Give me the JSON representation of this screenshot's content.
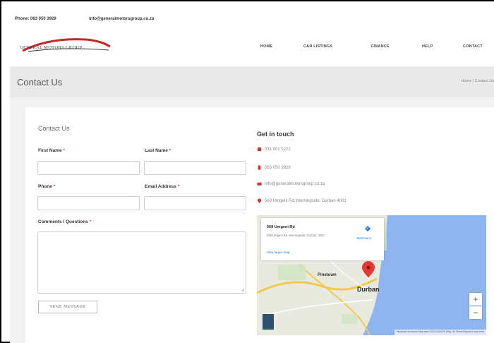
{
  "topbar": {
    "phone": "Phone: 063 050 3929",
    "email": "info@generalmotorsgroup.co.za"
  },
  "header": {
    "logo_text": "GENERAL MOTORS GROUP",
    "nav": [
      "HOME",
      "CAR LISTINGS",
      "FINANCE",
      "HELP",
      "CONTACT"
    ]
  },
  "titlebar": {
    "title": "Contact Us",
    "breadcrumb": "Home / Contact Us"
  },
  "form": {
    "title": "Contact Us",
    "first_name_label": "First Name",
    "last_name_label": "Last Name",
    "phone_label": "Phone",
    "email_label": "Email Address",
    "comments_label": "Comments / Questions",
    "required_mark": "*",
    "send_label": "SEND MESSAGE"
  },
  "contact": {
    "title": "Get in touch",
    "phone1": "031 001 5222",
    "phone2": "063 050 3929",
    "email": "info@generalmotorsgroup.co.za",
    "address": "569 Umgeni Rd, Morningside, Durban 4001"
  },
  "map": {
    "place_title": "569 Umgeni Rd",
    "place_address": "569 Umgeni Rd, Morningside, Durban, 4001",
    "larger_map": "View larger map",
    "directions": "Directions",
    "label_city": "Durban",
    "label_pinetown": "Pinetown",
    "footer": "Keyboard shortcuts  Map data ©2023 AfriGIS (Pty) Ltd  Terms  Report a map error",
    "zoom_in": "+",
    "zoom_out": "−",
    "colors": {
      "sea": "#8fb5f0",
      "land": "#e8eadf",
      "road": "#f2c94c",
      "pin": "#e53935"
    }
  }
}
